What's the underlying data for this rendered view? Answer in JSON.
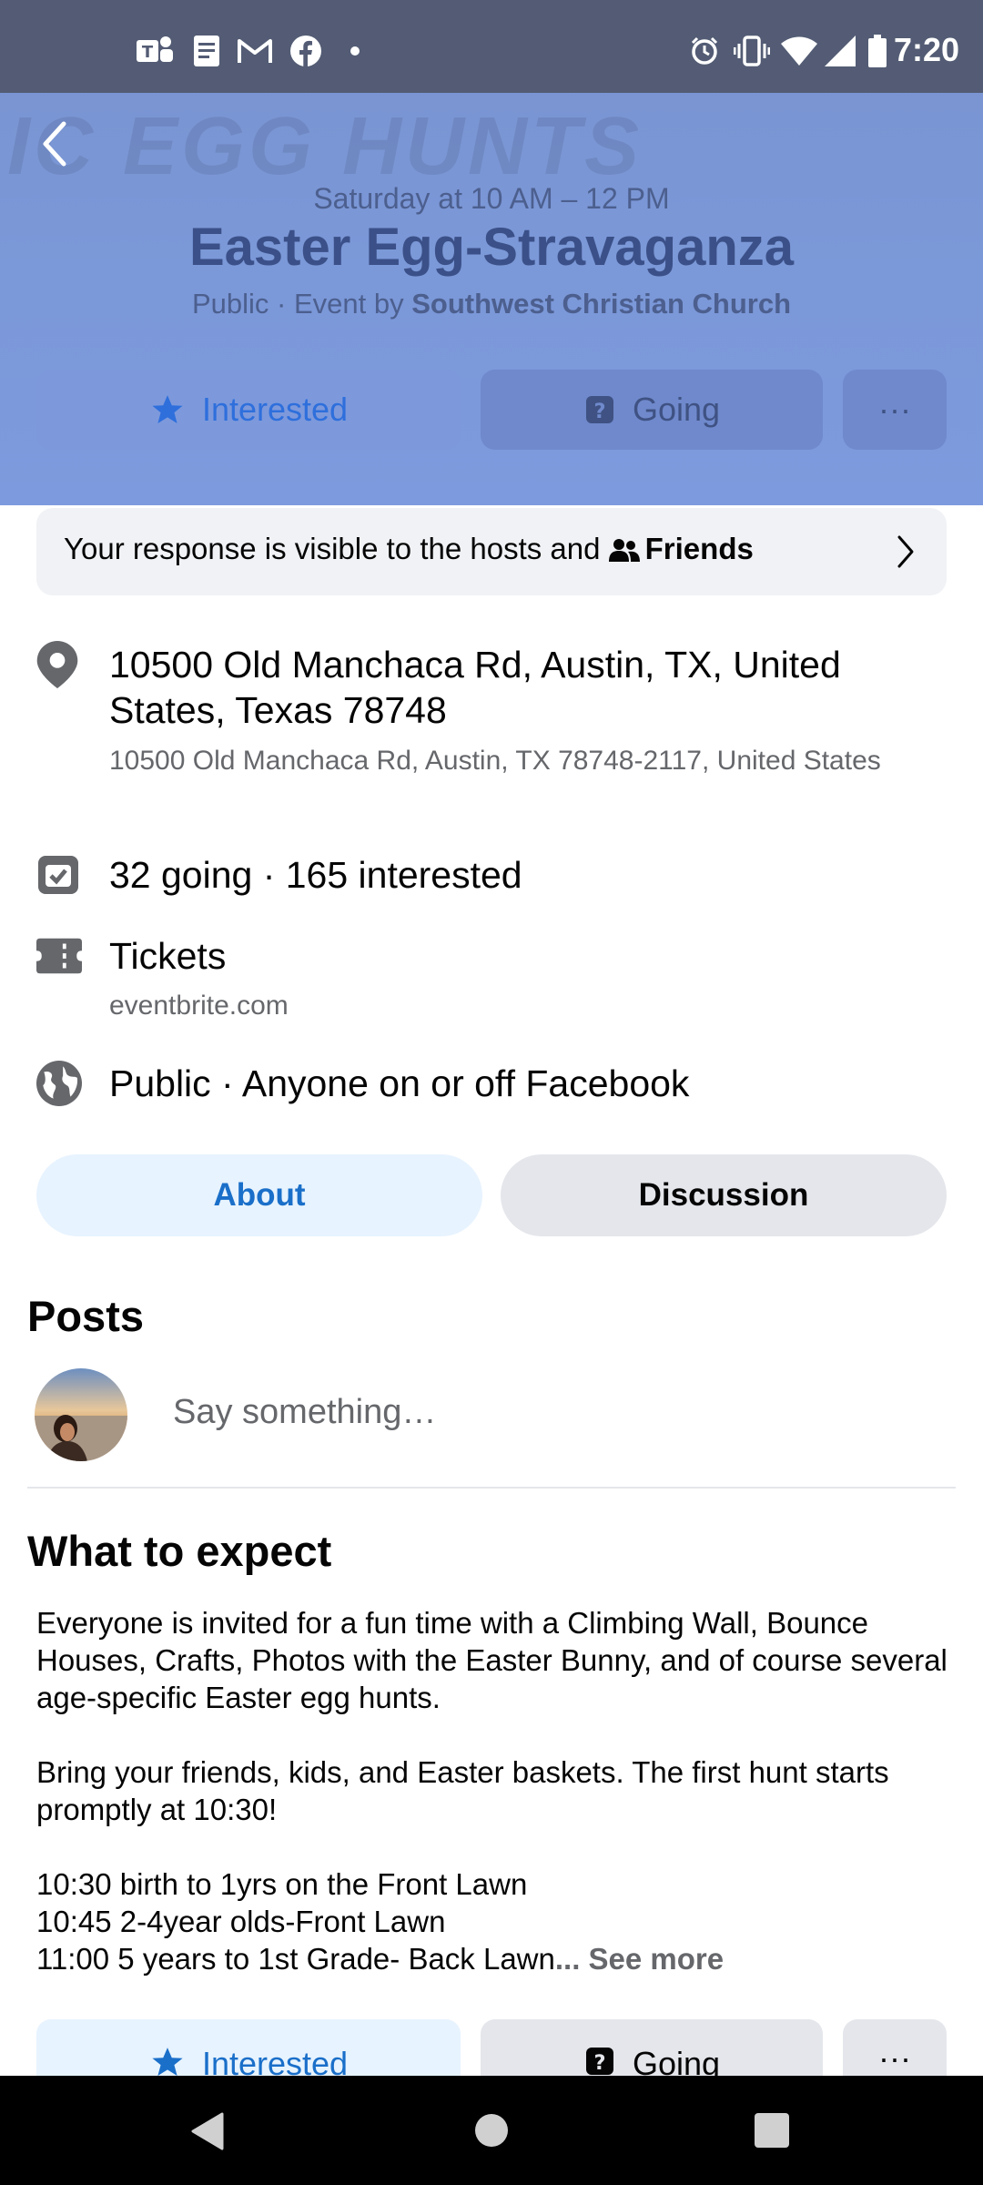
{
  "status_bar": {
    "time": "7:20",
    "left_icons": [
      "teams-icon",
      "document-icon",
      "gmail-icon",
      "facebook-icon",
      "dot-icon"
    ],
    "right_icons": [
      "alarm-icon",
      "vibrate-icon",
      "wifi-icon",
      "signal-icon",
      "battery-icon"
    ]
  },
  "header": {
    "watermark": "IC EGG HUNTS",
    "date": "Saturday at 10 AM – 12 PM",
    "title": "Easter Egg-Stravaganza",
    "host_prefix": "Public · Event by ",
    "host_name": "Southwest Christian Church",
    "buttons": {
      "interested": "Interested",
      "going": "Going",
      "more": "···"
    }
  },
  "response_notice": {
    "text": "Your response is visible to the hosts and ",
    "audience": "Friends"
  },
  "details": {
    "address_title": "10500 Old Manchaca Rd, Austin, TX, United States, Texas 78748",
    "address_sub": "10500 Old Manchaca Rd, Austin, TX 78748-2117, United States",
    "attendance": "32 going · 165 interested",
    "tickets_label": "Tickets",
    "tickets_site": "eventbrite.com",
    "privacy": "Public · Anyone on or off Facebook"
  },
  "tabs": {
    "about": "About",
    "discussion": "Discussion"
  },
  "posts": {
    "title": "Posts",
    "placeholder": "Say something…"
  },
  "what_to_expect": {
    "title": "What to expect",
    "p1": "Everyone is invited for a fun time with a Climbing Wall, Bounce Houses, Crafts, Photos with the Easter Bunny, and of course several age-specific Easter egg hunts.",
    "p2": "Bring your friends, kids, and Easter baskets. The first hunt starts promptly at 10:30!",
    "line1": "10:30 birth to 1yrs on the Front Lawn",
    "line2": "10:45 2-4year olds-Front Lawn",
    "line3": "11:00 5 years to 1st Grade- Back Lawn",
    "see_more": "... See more"
  },
  "colors": {
    "accent_blue": "#1a6fc9",
    "header_bg": "#7b98d8",
    "status_bar_bg": "#535c74"
  }
}
